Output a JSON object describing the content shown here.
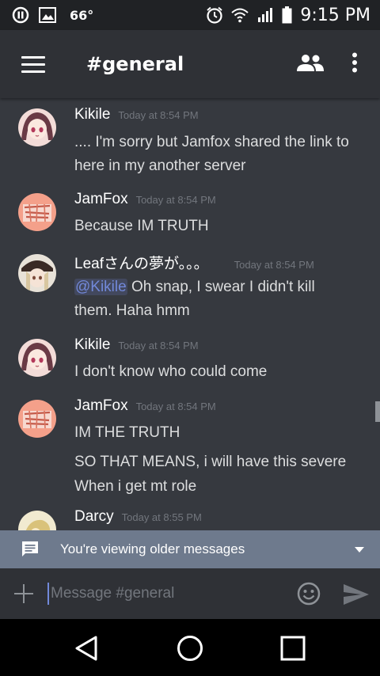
{
  "status_bar": {
    "temperature": "66°",
    "time": "9:15 PM",
    "icons": [
      "pause-circle-icon",
      "image-icon",
      "alarm-icon",
      "wifi-icon",
      "signal-icon",
      "battery-icon"
    ]
  },
  "header": {
    "channel": "#general",
    "icons": [
      "menu-icon",
      "members-icon",
      "more-vert-icon"
    ]
  },
  "messages": [
    {
      "author": "Kikile",
      "timestamp": "Today at 8:54 PM",
      "lines": [
        ".... I'm sorry but Jamfox shared the link to",
        "here in my another server"
      ]
    },
    {
      "author": "JamFox",
      "timestamp": "Today at 8:54 PM",
      "lines": [
        "Because IM TRUTH"
      ]
    },
    {
      "author": "Leafさんの夢が。。。",
      "timestamp": "Today at 8:54 PM",
      "mention": "@Kikile",
      "lines": [
        " Oh snap, I swear I didn't kill",
        "them. Haha hmm"
      ]
    },
    {
      "author": "Kikile",
      "timestamp": "Today at 8:54 PM",
      "lines": [
        "I don't know who could come"
      ]
    },
    {
      "author": "JamFox",
      "timestamp": "Today at 8:54 PM",
      "lines": [
        "IM THE TRUTH",
        "SO THAT MEANS, i will have this severe",
        "When i get mt role"
      ]
    },
    {
      "author": "Darcy",
      "timestamp": "Today at 8:55 PM",
      "lines": []
    }
  ],
  "older_banner": {
    "text": "You're viewing older messages"
  },
  "composer": {
    "placeholder": "Message #general"
  },
  "colors": {
    "accent": "#7289da",
    "background": "#36393f",
    "header": "#2f3136",
    "banner": "#6e7a8d"
  }
}
